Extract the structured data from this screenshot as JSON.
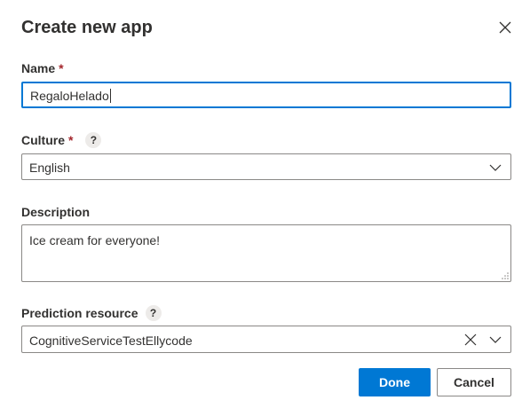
{
  "dialog": {
    "title": "Create new app",
    "close_icon": "close-icon"
  },
  "name_field": {
    "label": "Name",
    "required_marker": "*",
    "value": "RegaloHelado"
  },
  "culture_field": {
    "label": "Culture",
    "required_marker": "*",
    "help": "?",
    "value": "English",
    "icon": "chevron-down-icon"
  },
  "description_field": {
    "label": "Description",
    "value": "Ice cream for everyone!"
  },
  "prediction_field": {
    "label": "Prediction resource",
    "help": "?",
    "value": "CognitiveServiceTestEllycode",
    "clear_icon": "clear-icon",
    "icon": "chevron-down-icon"
  },
  "actions": {
    "done_label": "Done",
    "cancel_label": "Cancel"
  },
  "colors": {
    "primary": "#0078d4",
    "required": "#a4262c",
    "text": "#323130",
    "border": "#8a8886"
  }
}
